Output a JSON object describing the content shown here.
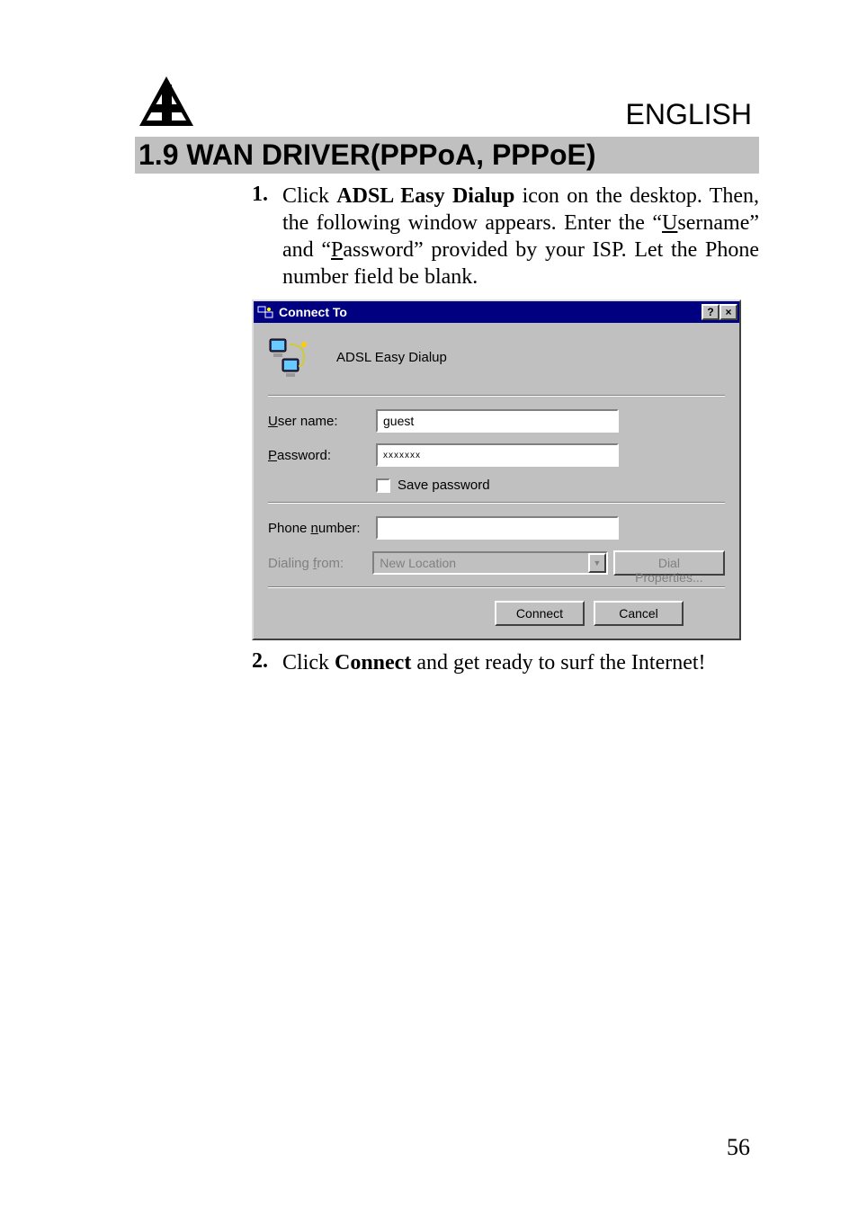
{
  "header": {
    "language": "ENGLISH"
  },
  "section": {
    "heading": "1.9 WAN DRIVER(PPPoA, PPPoE)"
  },
  "instructions": [
    {
      "num": "1.",
      "pre": "Click ",
      "bold": "ADSL Easy Dialup",
      "post1": " icon on the desktop. Then, the following window appears. Enter the “",
      "u1": "U",
      "post2": "sername” and “",
      "u2": "P",
      "post3": "assword” provided by your ISP. Let the Phone number field be blank."
    },
    {
      "num": "2.",
      "pre": "Click ",
      "bold": "Connect",
      "post1": " and get ready to surf the Internet!"
    }
  ],
  "dialog": {
    "title": "Connect To",
    "help_btn": "?",
    "close_btn": "×",
    "top_label": "ADSL Easy Dialup",
    "fields": {
      "user_label_mn": "U",
      "user_label_rest": "ser name:",
      "user_value": "guest",
      "password_label_mn": "P",
      "password_label_rest": "assword:",
      "password_value": "xxxxxxx",
      "save_password_mn": "S",
      "save_password_rest": "ave password",
      "phone_label_pre": "Phone ",
      "phone_label_mn": "n",
      "phone_label_post": "umber:",
      "phone_value": "",
      "dialing_from_pre": "Dialing ",
      "dialing_from_mn": "f",
      "dialing_from_post": "rom:",
      "dialing_from_value": "New Location",
      "dial_properties_mn": "D",
      "dial_properties_rest": "ial Properties..."
    },
    "buttons": {
      "connect": "Connect",
      "cancel": "Cancel"
    }
  },
  "page_number": "56"
}
